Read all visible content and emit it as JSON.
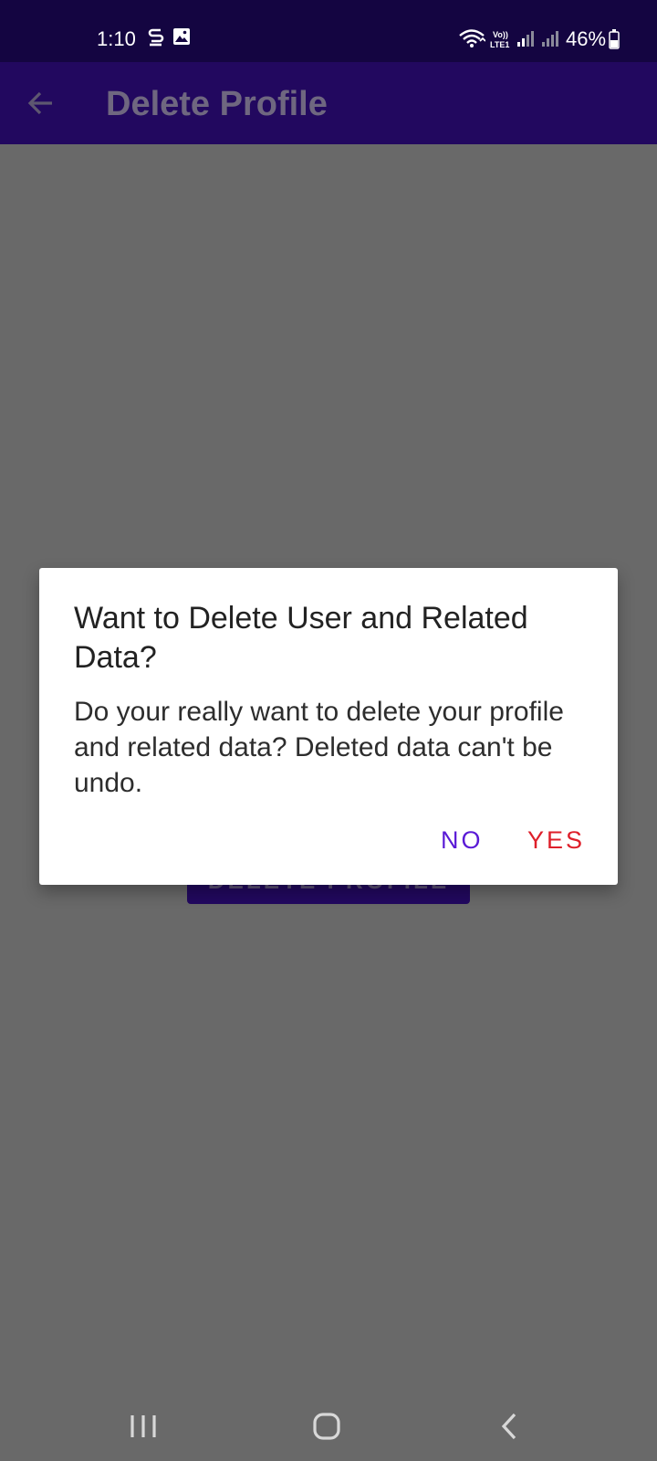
{
  "status_bar": {
    "time": "1:10",
    "battery": "46%",
    "icons": [
      "s-circle-icon",
      "image-icon",
      "wifi-icon",
      "volte-icon",
      "signal-icon",
      "signal-icon",
      "battery-icon"
    ]
  },
  "app_bar": {
    "title": "Delete Profile",
    "back_icon": "back-arrow-icon"
  },
  "main": {
    "button_label": "DELETE PROFILE"
  },
  "dialog": {
    "title": "Want to Delete User and Related Data?",
    "message": "Do your really want to delete your profile and related data? Deleted data can't be undo.",
    "no_label": "NO",
    "yes_label": "YES"
  },
  "nav_bar": {
    "icons": [
      "recent-apps-icon",
      "home-icon",
      "back-icon"
    ]
  },
  "colors": {
    "status_bar": "#140541",
    "app_bar": "#22085f",
    "overlay": "#696969",
    "dialog_bg": "#ffffff",
    "no_button": "#5a1ad6",
    "yes_button": "#de1f2a"
  }
}
